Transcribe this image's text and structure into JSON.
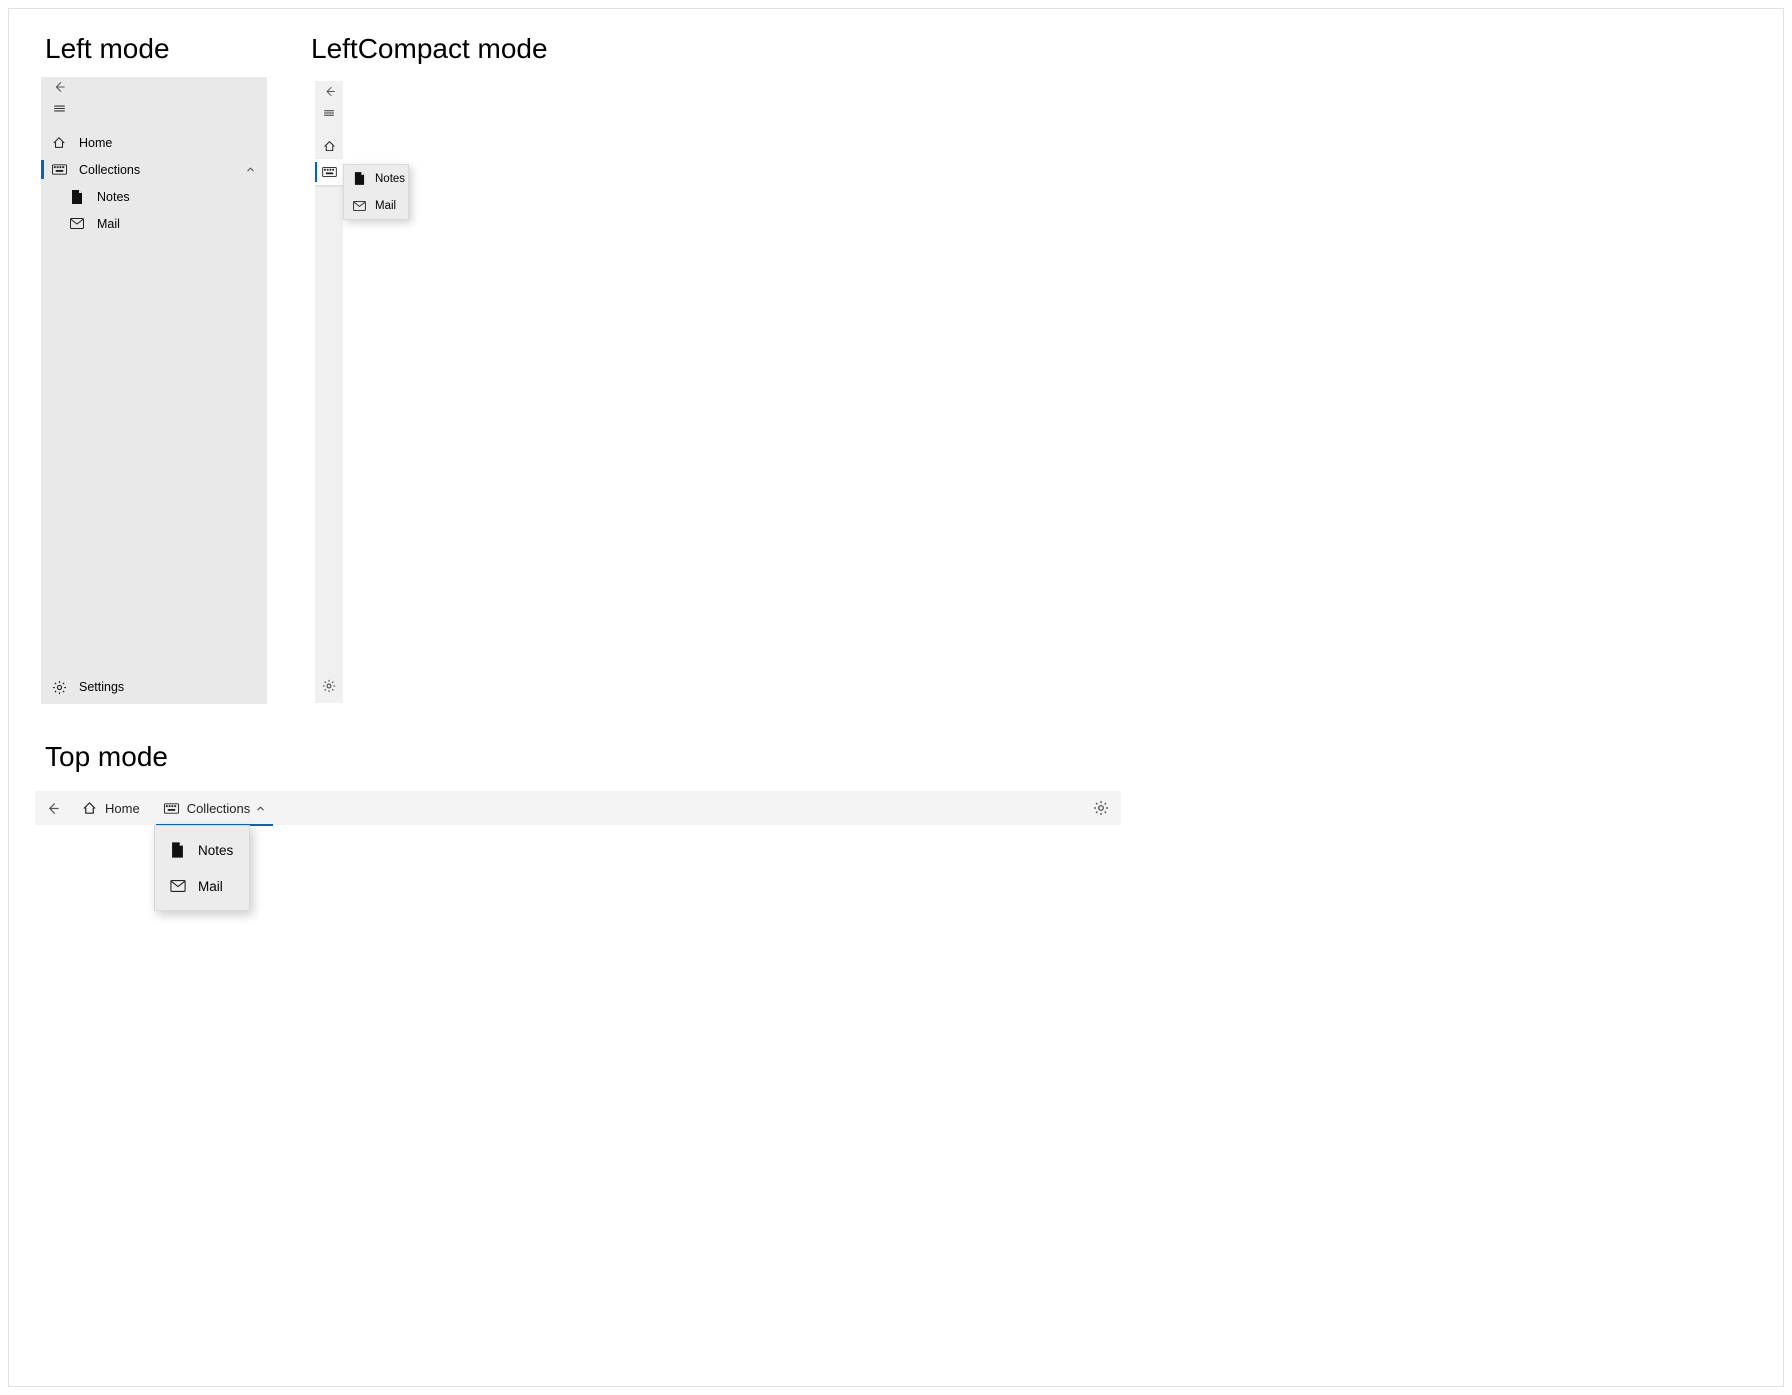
{
  "titles": {
    "left": "Left mode",
    "compact": "LeftCompact mode",
    "top": "Top mode"
  },
  "nav": {
    "home": "Home",
    "collections": "Collections",
    "notes": "Notes",
    "mail": "Mail",
    "settings": "Settings"
  }
}
